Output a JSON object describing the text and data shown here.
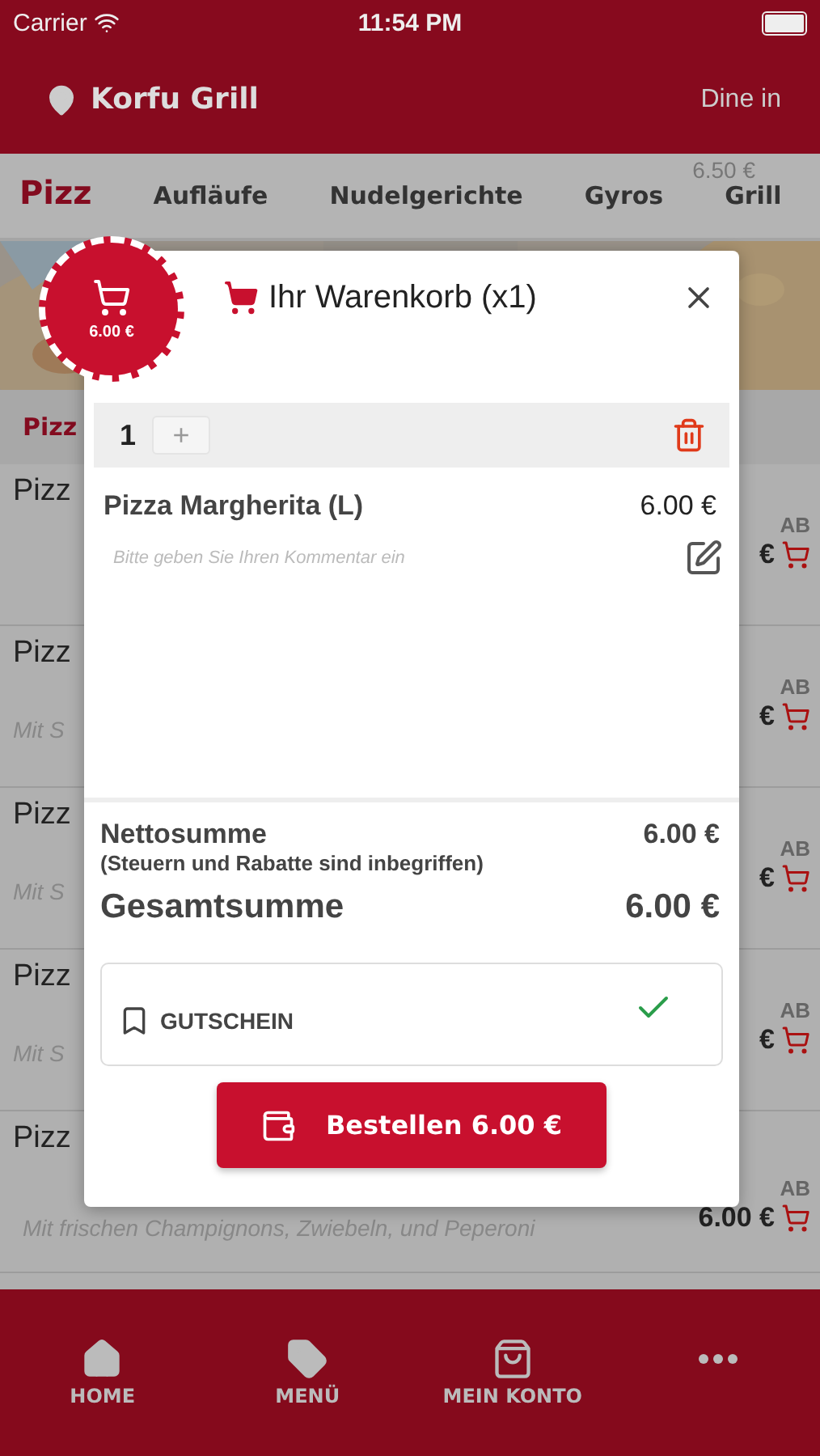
{
  "status_bar": {
    "carrier": "Carrier",
    "time": "11:54 PM"
  },
  "header": {
    "location": "Korfu Grill",
    "mode": "Dine in"
  },
  "price_hint": "6.50 €",
  "tabs": [
    {
      "label": "Pizz",
      "selected": true
    },
    {
      "label": "Aufläufe",
      "selected": false
    },
    {
      "label": "Nudelgerichte",
      "selected": false
    },
    {
      "label": "Gyros",
      "selected": false
    },
    {
      "label": "Grill",
      "selected": false
    }
  ],
  "section_title": "Pizz",
  "rows": [
    {
      "title": "Pizz",
      "prefix": "AB",
      "price": "€"
    },
    {
      "title": "Pizz",
      "description": "Mit S",
      "prefix": "AB",
      "price": "€"
    },
    {
      "title": "Pizz",
      "description": "Mit S",
      "prefix": "AB",
      "price": "€"
    },
    {
      "title": "Pizz",
      "description": "Mit S",
      "prefix": "AB",
      "price": "€"
    },
    {
      "title": "Pizz",
      "description": "Mit frischen Champignons, Zwiebeln, und Peperoni",
      "prefix": "AB",
      "price": "6.00 €"
    }
  ],
  "cart_badge": {
    "amount": "6.00 €"
  },
  "cart": {
    "title": "Ihr Warenkorb (x1)",
    "quantity": "1",
    "increment": "+",
    "items": [
      {
        "name": "Pizza Margherita (L)",
        "price": "6.00 €",
        "comment_placeholder": "Bitte geben Sie Ihren Kommentar ein"
      }
    ],
    "net_label": "Nettosumme",
    "net_note": "(Steuern und Rabatte sind inbegriffen)",
    "net_value": "6.00 €",
    "total_label": "Gesamtsumme",
    "total_value": "6.00 €",
    "coupon": {
      "label": "GUTSCHEIN",
      "applied": true
    },
    "order_button": "Bestellen 6.00 €"
  },
  "nav": [
    {
      "kind": "home",
      "label": "HOME"
    },
    {
      "kind": "tag",
      "label": "MENÜ"
    },
    {
      "kind": "bag",
      "label": "MEIN KONTO"
    },
    {
      "kind": "more"
    }
  ]
}
